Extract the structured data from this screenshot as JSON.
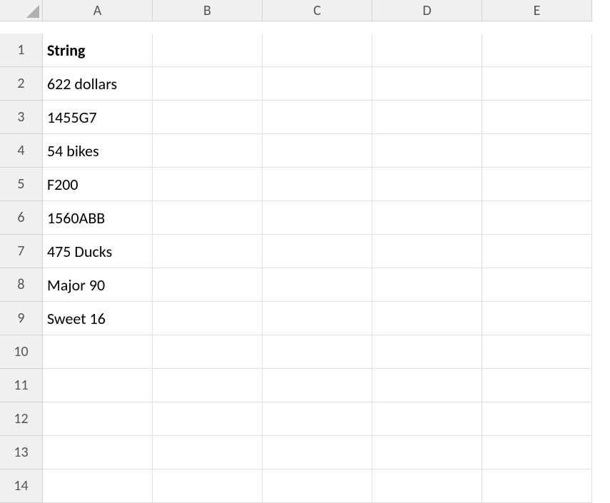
{
  "columns": [
    "A",
    "B",
    "C",
    "D",
    "E"
  ],
  "rowCount": 14,
  "cells": {
    "A1": {
      "value": "String",
      "bold": true
    },
    "A2": {
      "value": "622 dollars"
    },
    "A3": {
      "value": "1455G7"
    },
    "A4": {
      "value": "54 bikes"
    },
    "A5": {
      "value": "F200"
    },
    "A6": {
      "value": "1560ABB"
    },
    "A7": {
      "value": "475 Ducks"
    },
    "A8": {
      "value": "Major 90"
    },
    "A9": {
      "value": "Sweet 16"
    }
  }
}
